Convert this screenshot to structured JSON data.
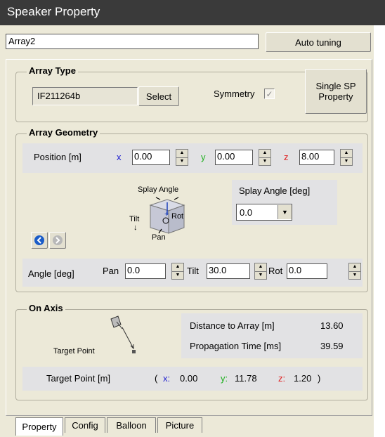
{
  "window": {
    "title": "Speaker Property"
  },
  "name_field": {
    "value": "Array2"
  },
  "auto_tuning": {
    "label": "Auto tuning"
  },
  "array_type": {
    "title": "Array Type",
    "model": "IF211264b",
    "select_label": "Select",
    "symmetry_label": "Symmetry",
    "symmetry_checked": true,
    "single_sp_line1": "Single SP",
    "single_sp_line2": "Property"
  },
  "geometry": {
    "title": "Array Geometry",
    "position_label": "Position [m]",
    "x_label": "x",
    "x_value": "0.00",
    "y_label": "y",
    "y_value": "0.00",
    "z_label": "z",
    "z_value": "8.00",
    "diagram": {
      "splay": "Splay Angle",
      "tilt": "Tilt",
      "rot": "Rot",
      "pan": "Pan"
    },
    "splay_label": "Splay Angle [deg]",
    "splay_value": "0.0",
    "angle_label": "Angle [deg]",
    "pan_label": "Pan",
    "pan_value": "0.0",
    "tilt_label": "Tilt",
    "tilt_value": "30.0",
    "rot_label": "Rot",
    "rot_value": "0.0"
  },
  "on_axis": {
    "title": "On Axis",
    "target_point_caption": "Target Point",
    "distance_label": "Distance to Array [m]",
    "distance_value": "13.60",
    "propagation_label": "Propagation Time [ms]",
    "propagation_value": "39.59",
    "target_label": "Target Point [m]",
    "open_paren": "(",
    "tx_label": "x:",
    "tx_value": "0.00",
    "ty_label": "y:",
    "ty_value": "11.78",
    "tz_label": "z:",
    "tz_value": "1.20",
    "close_paren": ")"
  },
  "tabs": [
    "Property",
    "Config",
    "Balloon",
    "Picture"
  ],
  "colors": {
    "x_axis": "#2020d0",
    "y_axis": "#20b020",
    "z_axis": "#e02020",
    "nav_active": "#1a5cc8",
    "title_bg": "#3a3a3a"
  }
}
